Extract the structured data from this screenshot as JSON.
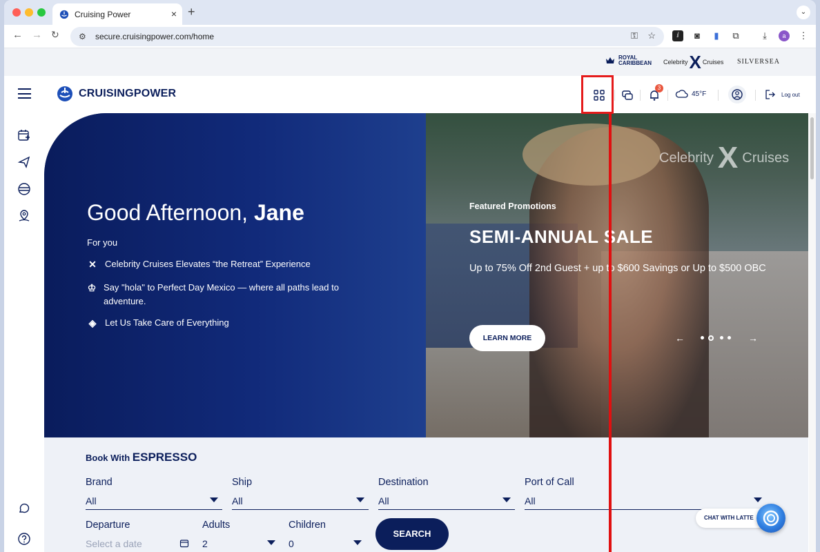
{
  "browser": {
    "tab_title": "Cruising Power",
    "tab_close": "×",
    "new_tab": "+",
    "url": "secure.cruisingpower.com/home"
  },
  "brands": {
    "royal_line1": "ROYAL",
    "royal_line2": "CARIBBEAN",
    "celebrity_left": "Celebrity",
    "celebrity_x": "X",
    "celebrity_right": "Cruises",
    "silversea": "SILVERSEA"
  },
  "header": {
    "logo_text": "CRUISINGPOWER",
    "notification_count": "3",
    "weather": "45°F",
    "logout": "Log out"
  },
  "hero": {
    "greeting_prefix": "Good Afternoon, ",
    "greeting_name": "Jane",
    "for_you": "For you",
    "items": [
      {
        "text": "Celebrity Cruises Elevates “the Retreat” Experience"
      },
      {
        "text": "Say \"hola\" to Perfect Day Mexico — where all paths lead to adventure."
      },
      {
        "text": "Let Us Take Care of Everything"
      }
    ],
    "watermark_left": "Celebrity",
    "watermark_right": "Cruises",
    "promo_kicker": "Featured Promotions",
    "promo_title": "SEMI-ANNUAL SALE",
    "promo_desc": "Up to 75% Off 2nd Guest + up to $600 Savings or Up to $500 OBC",
    "learn_more": "LEARN MORE",
    "carousel_prev": "←",
    "carousel_next": "→"
  },
  "booking": {
    "title_prefix": "Book With ",
    "title_brand": "ESPRESSO",
    "brand_label": "Brand",
    "brand_value": "All",
    "ship_label": "Ship",
    "ship_value": "All",
    "destination_label": "Destination",
    "destination_value": "All",
    "port_label": "Port of Call",
    "port_value": "All",
    "departure_label": "Departure",
    "departure_placeholder": "Select a date",
    "adults_label": "Adults",
    "adults_value": "2",
    "children_label": "Children",
    "children_value": "0",
    "search": "SEARCH"
  },
  "chat": {
    "label": "CHAT WITH LATTE"
  },
  "colors": {
    "brand_navy": "#0b1e5b",
    "highlight_red": "#e51b1b",
    "badge": "#e9573f"
  }
}
